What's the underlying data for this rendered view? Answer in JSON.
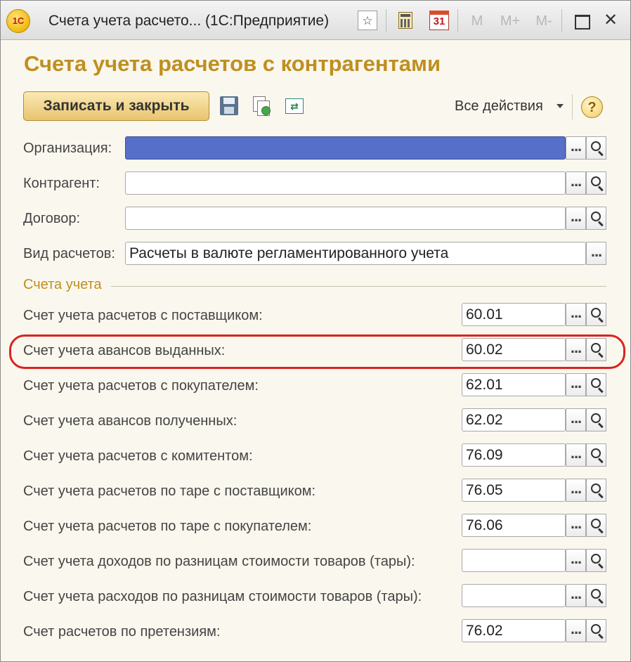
{
  "window": {
    "logo_text": "1С",
    "title": "Счета учета расчето... (1С:Предприятие)",
    "icons": {
      "favorite": "star-icon",
      "calculator": "calculator-icon",
      "calendar": "calendar-icon",
      "calendar_text": "31",
      "m": "M",
      "m_plus": "M+",
      "m_minus": "M-",
      "maximize": "maximize-icon",
      "close": "close-icon",
      "close_glyph": "✕"
    }
  },
  "form": {
    "title": "Счета учета расчетов с контрагентами",
    "accent_color": "#bf8f1f"
  },
  "toolbar": {
    "save_close_label": "Записать и закрыть",
    "save_icon": "floppy-disk-icon",
    "copy_icon": "copy-documents-icon",
    "exchange_icon": "exchange-icon",
    "all_actions_label": "Все действия",
    "help_glyph": "?"
  },
  "header_fields": [
    {
      "label": "Организация:",
      "value": ""
    },
    {
      "label": "Контрагент:",
      "value": ""
    },
    {
      "label": "Договор:",
      "value": ""
    },
    {
      "label": "Вид расчетов:",
      "value": "Расчеты в валюте регламентированного учета"
    }
  ],
  "accounts_group": {
    "title": "Счета учета",
    "rows": [
      {
        "label": "Счет учета расчетов с поставщиком:",
        "value": "60.01"
      },
      {
        "label": "Счет учета авансов выданных:",
        "value": "60.02",
        "highlighted": true
      },
      {
        "label": "Счет учета расчетов с покупателем:",
        "value": "62.01"
      },
      {
        "label": "Счет учета авансов полученных:",
        "value": "62.02"
      },
      {
        "label": "Счет учета расчетов с комитентом:",
        "value": "76.09"
      },
      {
        "label": "Счет учета расчетов по таре с поставщиком:",
        "value": "76.05"
      },
      {
        "label": "Счет учета расчетов по таре с покупателем:",
        "value": "76.06"
      },
      {
        "label": "Счет учета доходов по разницам стоимости товаров (тары):",
        "value": ""
      },
      {
        "label": "Счет учета расходов по разницам стоимости товаров (тары):",
        "value": ""
      },
      {
        "label": "Счет расчетов по претензиям:",
        "value": "76.02"
      }
    ]
  },
  "buttons": {
    "choose_glyph": "...",
    "open_icon": "magnifier-icon"
  },
  "highlight_color": "#d9231f"
}
